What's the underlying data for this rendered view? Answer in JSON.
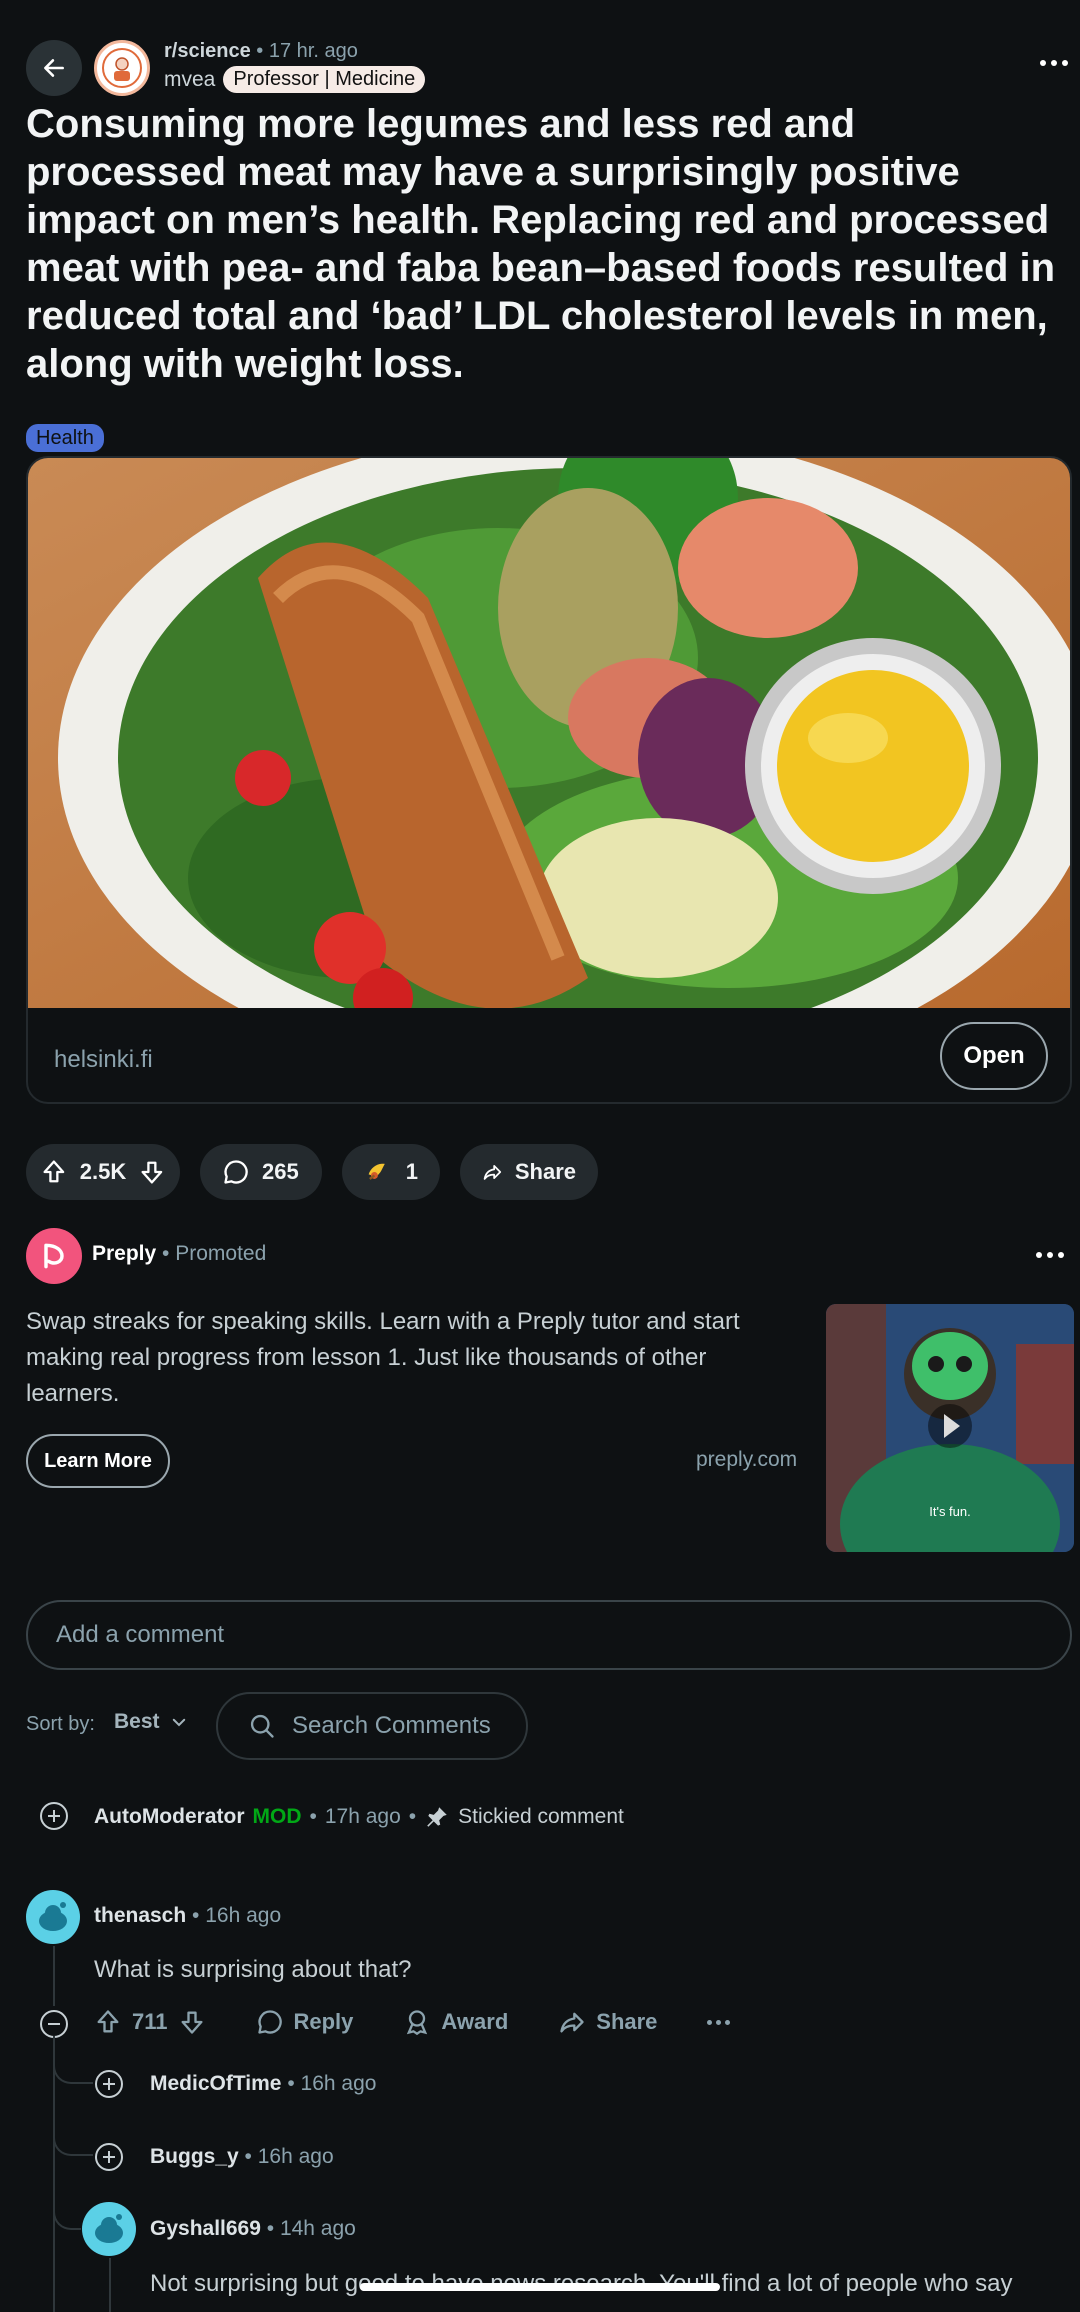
{
  "header": {
    "subreddit": "r/science",
    "post_age": "17 hr. ago",
    "author": "mvea",
    "flair": "Professor | Medicine"
  },
  "post": {
    "title": "Consuming more legumes and less red and processed meat may have a surprisingly positive impact on men’s health. Replacing red and processed meat with pea- and faba bean–based foods resulted in reduced total and ‘bad’ LDL cholesterol levels in men, along with weight loss.",
    "tag": "Health",
    "link_domain": "helsinki.fi",
    "open_label": "Open"
  },
  "actions": {
    "upvotes": "2.5K",
    "comments": "265",
    "awards": "1",
    "share": "Share"
  },
  "ad": {
    "advertiser": "Preply",
    "promoted": "Promoted",
    "body": "Swap streaks for speaking skills. Learn with a Preply tutor and start making real progress from lesson 1. Just like thousands of other learners.",
    "cta": "Learn More",
    "domain": "preply.com",
    "video_caption": "It's fun."
  },
  "comment_box": {
    "placeholder": "Add a comment"
  },
  "sort": {
    "label": "Sort by:",
    "value": "Best",
    "search_placeholder": "Search Comments"
  },
  "comments": {
    "automod": {
      "name": "AutoModerator",
      "badge": "MOD",
      "age": "17h ago",
      "sticky": "Stickied comment"
    },
    "c1": {
      "name": "thenasch",
      "age": "16h ago",
      "text": "What is surprising about that?",
      "votes": "711",
      "reply": "Reply",
      "award": "Award",
      "share": "Share"
    },
    "c2": {
      "name": "MedicOfTime",
      "age": "16h ago"
    },
    "c3": {
      "name": "Buggs_y",
      "age": "16h ago"
    },
    "c4": {
      "name": "Gyshall669",
      "age": "14h ago",
      "text": "Not surprising but good to have news research. You'll find a lot of people who say"
    }
  },
  "colors": {
    "background": "#0e1113",
    "tag": "#4a6fd6",
    "mod": "#01a816"
  }
}
